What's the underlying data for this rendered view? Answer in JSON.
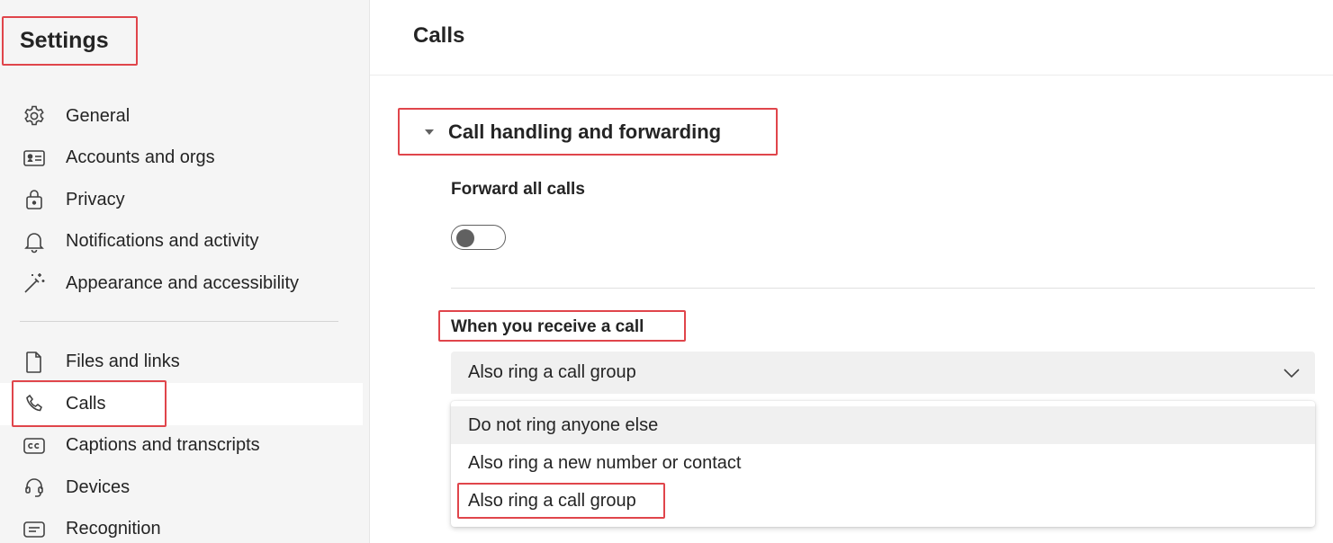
{
  "sidebar": {
    "title": "Settings",
    "items_group1": [
      {
        "label": "General",
        "icon": "gear-icon"
      },
      {
        "label": "Accounts and orgs",
        "icon": "id-card-icon"
      },
      {
        "label": "Privacy",
        "icon": "lock-icon"
      },
      {
        "label": "Notifications and activity",
        "icon": "bell-icon"
      },
      {
        "label": "Appearance and accessibility",
        "icon": "magic-wand-icon"
      }
    ],
    "items_group2": [
      {
        "label": "Files and links",
        "icon": "file-icon"
      },
      {
        "label": "Calls",
        "icon": "phone-icon",
        "selected": true
      },
      {
        "label": "Captions and transcripts",
        "icon": "cc-icon"
      },
      {
        "label": "Devices",
        "icon": "headset-icon"
      },
      {
        "label": "Recognition",
        "icon": "recognition-icon"
      }
    ]
  },
  "main": {
    "title": "Calls",
    "section": {
      "title": "Call handling and forwarding",
      "forward_label": "Forward all calls",
      "forward_enabled": false,
      "receive_label": "When you receive a call",
      "dropdown": {
        "selected": "Also ring a call group",
        "options": [
          "Do not ring anyone else",
          "Also ring a new number or contact",
          "Also ring a call group"
        ]
      }
    }
  },
  "colors": {
    "highlight_border": "#e0454b",
    "sidebar_bg": "#f5f5f5",
    "text": "#242424",
    "icon": "#616161"
  }
}
